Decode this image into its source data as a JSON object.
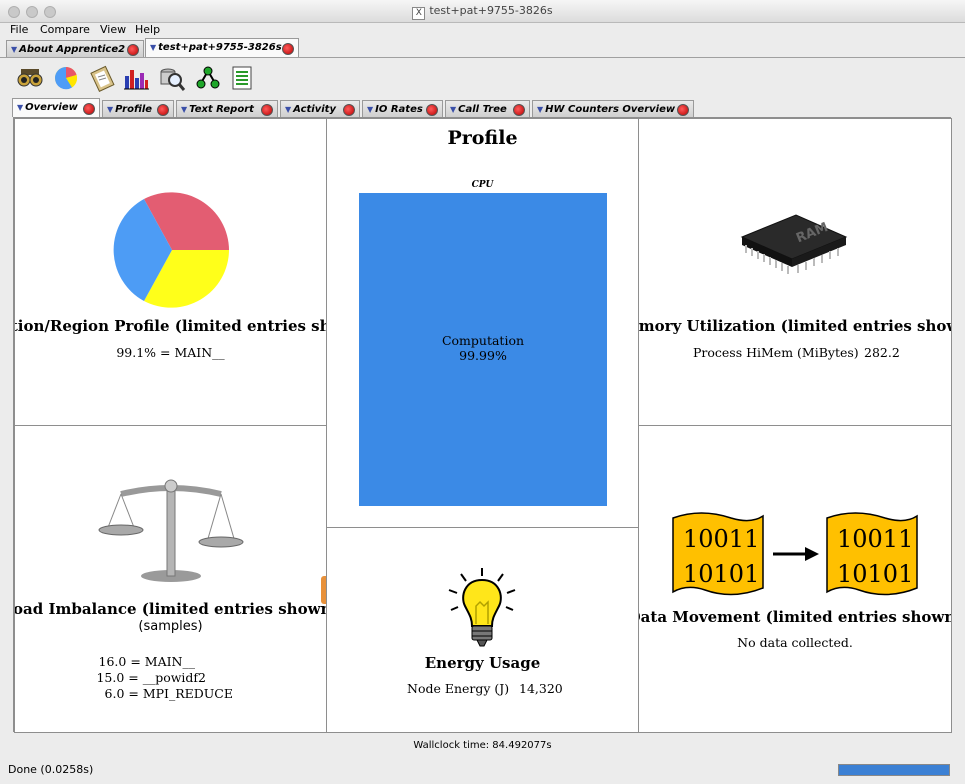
{
  "window": {
    "title": "test+pat+9755-3826s"
  },
  "menu": [
    "File",
    "Compare",
    "View",
    "Help"
  ],
  "doc_tabs": [
    {
      "label": "About Apprentice2",
      "active": false
    },
    {
      "label": "test+pat+9755-3826s",
      "active": true
    }
  ],
  "toolbar_icons": [
    "binoculars-icon",
    "pie-chart-icon",
    "clipboard-icon",
    "histogram-icon",
    "magnifier-database-icon",
    "tree-icon",
    "document-list-icon"
  ],
  "view_tabs": [
    {
      "label": "Overview",
      "active": true
    },
    {
      "label": "Profile",
      "active": false
    },
    {
      "label": "Text Report",
      "active": false
    },
    {
      "label": "Activity",
      "active": false
    },
    {
      "label": "IO Rates",
      "active": false
    },
    {
      "label": "Call Tree",
      "active": false
    },
    {
      "label": "HW Counters Overview",
      "active": false
    }
  ],
  "function_profile": {
    "title": "Function/Region Profile (limited entries shown)",
    "entry": "99.1% = MAIN__"
  },
  "profile": {
    "title": "Profile",
    "bar_label": "CPU",
    "segment_label": "Computation",
    "segment_value": "99.99%",
    "color": "#3b8ae6"
  },
  "memory": {
    "title": "Memory Utilization (limited entries shown)",
    "label": "Process HiMem (MiBytes)",
    "value": "282.2"
  },
  "load_imbalance": {
    "title": "Load Imbalance (limited entries shown)",
    "subtitle": "(samples)",
    "entries": [
      "16.0 = MAIN__",
      "15.0 = __powidf2",
      "6.0 = MPI_REDUCE"
    ]
  },
  "energy": {
    "title": "Energy Usage",
    "label": "Node Energy (J)",
    "value": "14,320"
  },
  "data_movement": {
    "title": "Data Movement (limited entries shown)",
    "message": "No data collected.",
    "binary_line1": "10011",
    "binary_line2": "10101"
  },
  "wallclock": "Wallclock time: 84.492077s",
  "status": "Done (0.0258s)",
  "progress_fraction": 1.0
}
